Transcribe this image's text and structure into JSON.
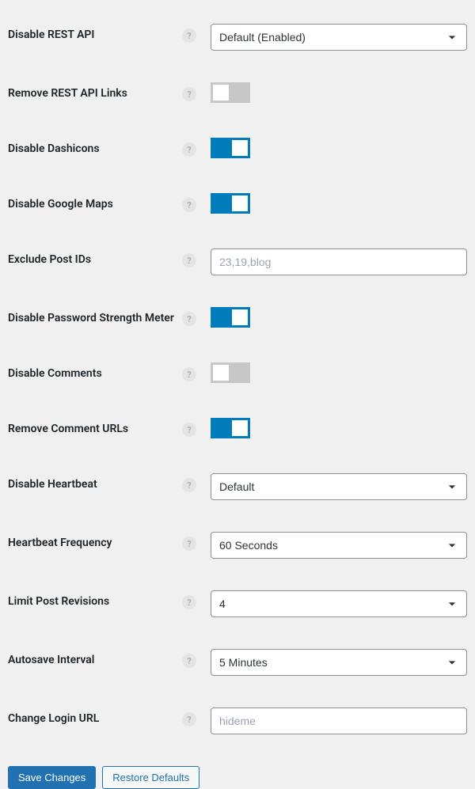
{
  "help_glyph": "?",
  "settings": {
    "disable_rest_api": {
      "label": "Disable REST API",
      "value": "Default (Enabled)"
    },
    "remove_rest_api_links": {
      "label": "Remove REST API Links",
      "on": false
    },
    "disable_dashicons": {
      "label": "Disable Dashicons",
      "on": true
    },
    "disable_google_maps": {
      "label": "Disable Google Maps",
      "on": true
    },
    "exclude_post_ids": {
      "label": "Exclude Post IDs",
      "placeholder": "23,19,blog",
      "value": ""
    },
    "disable_password_strength_meter": {
      "label": "Disable Password Strength Meter",
      "on": true
    },
    "disable_comments": {
      "label": "Disable Comments",
      "on": false
    },
    "remove_comment_urls": {
      "label": "Remove Comment URLs",
      "on": true
    },
    "disable_heartbeat": {
      "label": "Disable Heartbeat",
      "value": "Default"
    },
    "heartbeat_frequency": {
      "label": "Heartbeat Frequency",
      "value": "60 Seconds"
    },
    "limit_post_revisions": {
      "label": "Limit Post Revisions",
      "value": "4"
    },
    "autosave_interval": {
      "label": "Autosave Interval",
      "value": "5 Minutes"
    },
    "change_login_url": {
      "label": "Change Login URL",
      "placeholder": "hideme",
      "value": ""
    }
  },
  "buttons": {
    "save": "Save Changes",
    "restore": "Restore Defaults"
  }
}
